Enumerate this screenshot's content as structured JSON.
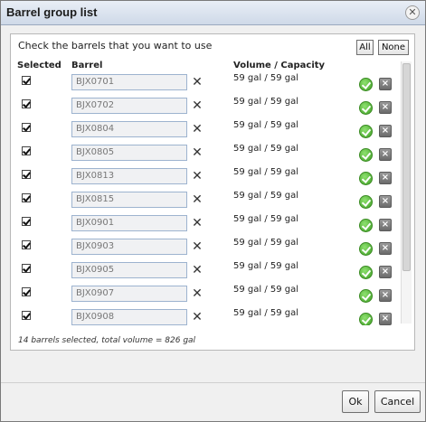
{
  "window": {
    "title": "Barrel group list",
    "close_glyph": "✕"
  },
  "instructions": "Check the barrels that you want to use",
  "select_buttons": {
    "all": "All",
    "none": "None"
  },
  "columns": {
    "selected": "Selected",
    "barrel": "Barrel",
    "volume": "Volume / Capacity"
  },
  "rows": [
    {
      "barrel": "BJX0701",
      "volume": "59 gal / 59 gal",
      "checked": true
    },
    {
      "barrel": "BJX0702",
      "volume": "59 gal / 59 gal",
      "checked": true
    },
    {
      "barrel": "BJX0804",
      "volume": "59 gal / 59 gal",
      "checked": true
    },
    {
      "barrel": "BJX0805",
      "volume": "59 gal / 59 gal",
      "checked": true
    },
    {
      "barrel": "BJX0813",
      "volume": "59 gal / 59 gal",
      "checked": true
    },
    {
      "barrel": "BJX0815",
      "volume": "59 gal / 59 gal",
      "checked": true
    },
    {
      "barrel": "BJX0901",
      "volume": "59 gal / 59 gal",
      "checked": true
    },
    {
      "barrel": "BJX0903",
      "volume": "59 gal / 59 gal",
      "checked": true
    },
    {
      "barrel": "BJX0905",
      "volume": "59 gal / 59 gal",
      "checked": true
    },
    {
      "barrel": "BJX0907",
      "volume": "59 gal / 59 gal",
      "checked": true
    },
    {
      "barrel": "BJX0908",
      "volume": "59 gal / 59 gal",
      "checked": true
    }
  ],
  "icons": {
    "clear": "close-icon",
    "ok": "check-circle-icon",
    "remove": "remove-icon"
  },
  "summary": "14 barrels selected, total volume = 826 gal",
  "footer": {
    "ok": "Ok",
    "cancel": "Cancel"
  },
  "colors": {
    "title_bar": "#cfd9e8",
    "ok_icon": "#3f9f25",
    "input_border": "#9db3cf"
  }
}
